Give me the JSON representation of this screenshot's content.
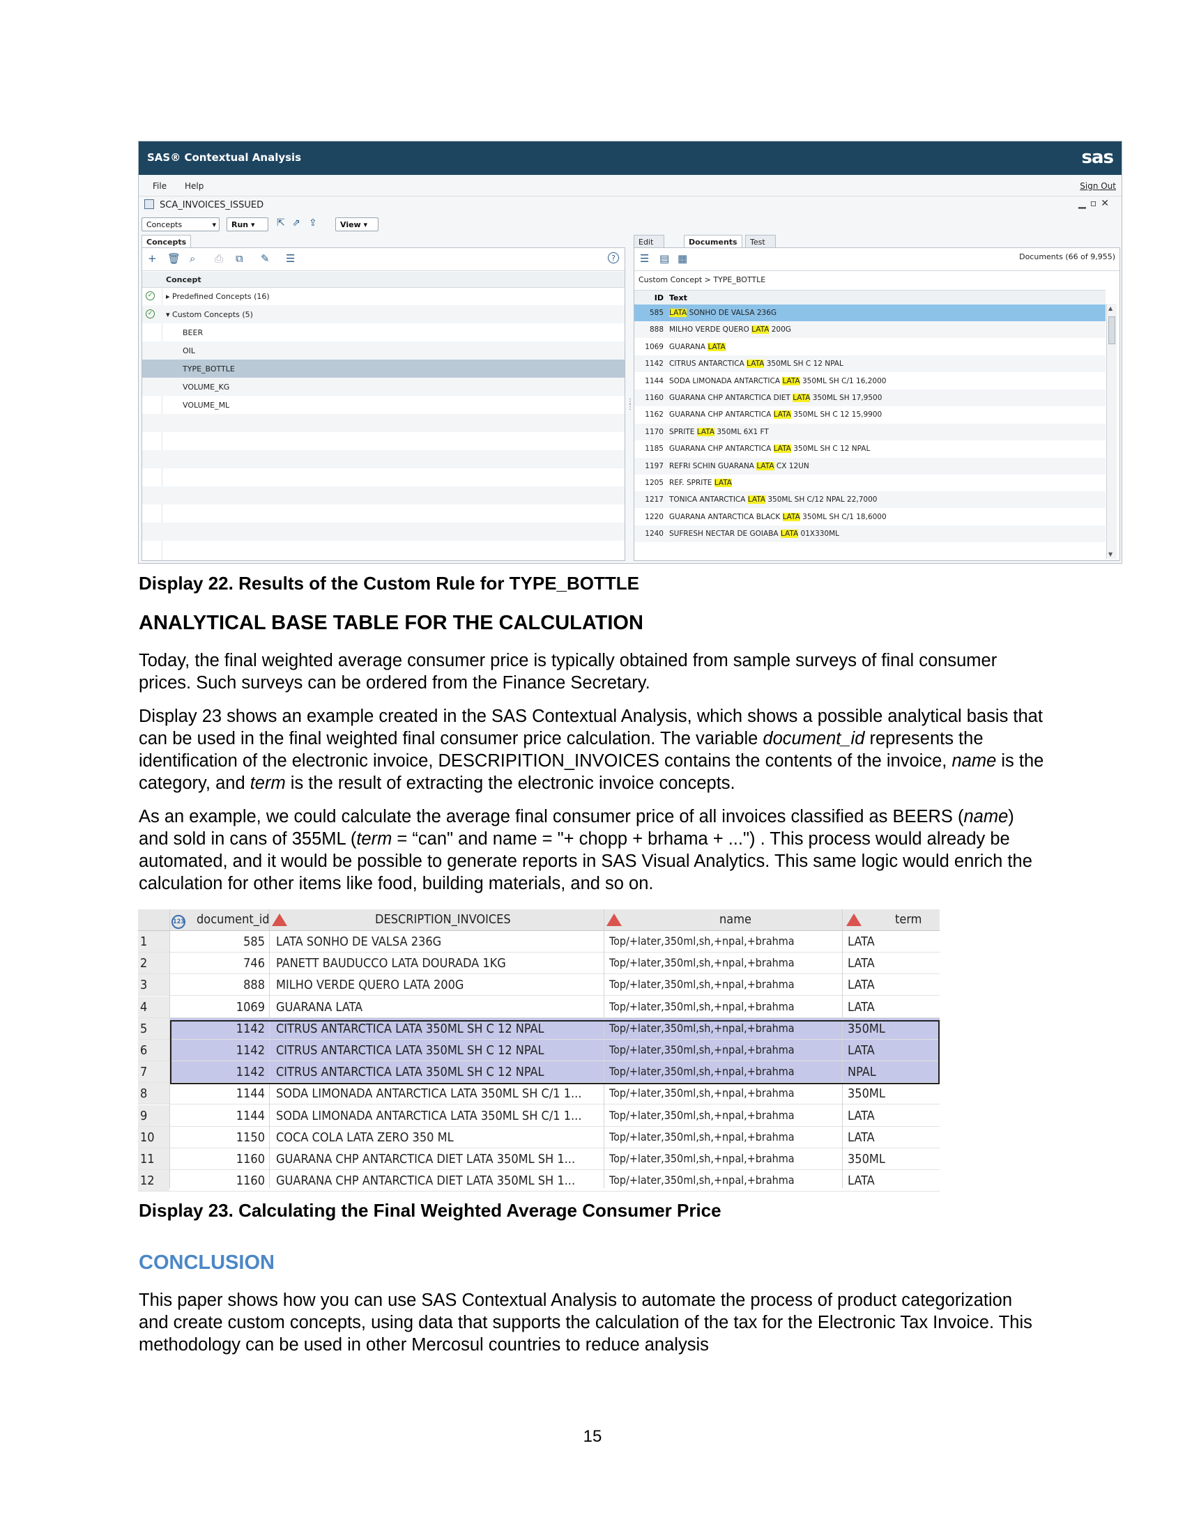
{
  "app": {
    "title": "SAS® Contextual Analysis",
    "logo": "sas",
    "menu": [
      "File",
      "Help"
    ],
    "sign_out": "Sign Out",
    "project": "SCA_INVOICES_ISSUED",
    "toolbar": {
      "concepts_select": "Concepts",
      "run": "Run",
      "view": "View"
    },
    "left_tab": "Concepts",
    "concept_header": "Concept",
    "concepts": [
      {
        "label": "▸ Predefined Concepts (16)",
        "check": true,
        "indent": false,
        "selected": false
      },
      {
        "label": "▾ Custom Concepts (5)",
        "check": true,
        "indent": false,
        "selected": false
      },
      {
        "label": "BEER",
        "check": false,
        "indent": true,
        "selected": false
      },
      {
        "label": "OIL",
        "check": false,
        "indent": true,
        "selected": false
      },
      {
        "label": "TYPE_BOTTLE",
        "check": false,
        "indent": true,
        "selected": true
      },
      {
        "label": "VOLUME_KG",
        "check": false,
        "indent": true,
        "selected": false
      },
      {
        "label": "VOLUME_ML",
        "check": false,
        "indent": true,
        "selected": false
      }
    ],
    "right_tabs": [
      "Edit Rules",
      "Documents",
      "Test Rules"
    ],
    "documents_info": "Documents (66 of 9,955)",
    "breadcrumb": "Custom Concept > TYPE_BOTTLE",
    "doc_headers": {
      "id": "ID",
      "text": "Text"
    },
    "documents": [
      {
        "id": "585",
        "pre": "",
        "hl": "LATA",
        "post": " SONHO DE VALSA 236G"
      },
      {
        "id": "888",
        "pre": "MILHO VERDE QUERO ",
        "hl": "LATA",
        "post": " 200G"
      },
      {
        "id": "1069",
        "pre": "GUARANA ",
        "hl": "LATA",
        "post": ""
      },
      {
        "id": "1142",
        "pre": "CITRUS ANTARCTICA ",
        "hl": "LATA",
        "post": " 350ML SH C 12 NPAL"
      },
      {
        "id": "1144",
        "pre": "SODA LIMONADA ANTARCTICA ",
        "hl": "LATA",
        "post": " 350ML SH C/1 16,2000"
      },
      {
        "id": "1160",
        "pre": "GUARANA CHP ANTARCTICA DIET ",
        "hl": "LATA",
        "post": " 350ML SH 17,9500"
      },
      {
        "id": "1162",
        "pre": "GUARANA CHP ANTARCTICA ",
        "hl": "LATA",
        "post": " 350ML SH C 12 15,9900"
      },
      {
        "id": "1170",
        "pre": "SPRITE ",
        "hl": "LATA",
        "post": " 350ML 6X1 FT"
      },
      {
        "id": "1185",
        "pre": "GUARANA CHP ANTARCTICA ",
        "hl": "LATA",
        "post": " 350ML SH C 12 NPAL"
      },
      {
        "id": "1197",
        "pre": "REFRI SCHIN GUARANA ",
        "hl": "LATA",
        "post": " CX 12UN"
      },
      {
        "id": "1205",
        "pre": "REF. SPRITE ",
        "hl": "LATA",
        "post": ""
      },
      {
        "id": "1217",
        "pre": "TONICA ANTARCTICA ",
        "hl": "LATA",
        "post": " 350ML SH C/12 NPAL 22,7000"
      },
      {
        "id": "1220",
        "pre": "GUARANA ANTARCTICA BLACK ",
        "hl": "LATA",
        "post": " 350ML SH C/1 18,6000"
      },
      {
        "id": "1240",
        "pre": "SUFRESH NECTAR DE GOIABA ",
        "hl": "LATA",
        "post": " 01X330ML"
      }
    ]
  },
  "caption22": "Display 22. Results of the Custom Rule for TYPE_BOTTLE",
  "heading_abt": "ANALYTICAL BASE TABLE FOR THE CALCULATION",
  "p1": "Today, the final weighted average consumer price is typically obtained from sample surveys of final consumer prices. Such surveys can be ordered from the Finance Secretary.",
  "p2": {
    "a": "Display 23 shows an example created in the SAS Contextual Analysis, which shows a possible analytical basis that can be used in the final weighted final consumer price calculation. The variable ",
    "b": "document_id",
    "c": " represents the identification of the electronic invoice, DESCRIPITION_INVOICES contains the contents of the invoice, ",
    "d": "name",
    "e": " is the category, and ",
    "f": "term",
    "g": " is the result of extracting the electronic invoice concepts."
  },
  "p3": {
    "a": "As an example, we could calculate the average final consumer price of all invoices classified as BEERS (",
    "b": "name",
    "c": ") and sold in cans of 355ML (",
    "d": "term",
    "e": " = “can\" and name = \"+ chopp + brhama + ...\") . This process would already be automated, and it would be possible to generate reports in SAS Visual Analytics. This same logic would enrich the calculation for other items like food, building materials, and so on."
  },
  "table": {
    "headers": {
      "id": "document_id",
      "desc": "DESCRIPTION_INVOICES",
      "name": "name",
      "term": "term"
    },
    "rows": [
      {
        "n": "1",
        "id": "585",
        "desc": "LATA SONHO DE VALSA 236G",
        "name": "Top/+later,350ml,sh,+npal,+brahma",
        "term": "LATA",
        "hl": false
      },
      {
        "n": "2",
        "id": "746",
        "desc": "PANETT BAUDUCCO LATA DOURADA 1KG",
        "name": "Top/+later,350ml,sh,+npal,+brahma",
        "term": "LATA",
        "hl": false
      },
      {
        "n": "3",
        "id": "888",
        "desc": "MILHO VERDE QUERO LATA 200G",
        "name": "Top/+later,350ml,sh,+npal,+brahma",
        "term": "LATA",
        "hl": false
      },
      {
        "n": "4",
        "id": "1069",
        "desc": "GUARANA LATA",
        "name": "Top/+later,350ml,sh,+npal,+brahma",
        "term": "LATA",
        "hl": false
      },
      {
        "n": "5",
        "id": "1142",
        "desc": "CITRUS ANTARCTICA LATA 350ML SH C 12 NPAL",
        "name": "Top/+later,350ml,sh,+npal,+brahma",
        "term": "350ML",
        "hl": true
      },
      {
        "n": "6",
        "id": "1142",
        "desc": "CITRUS ANTARCTICA LATA 350ML SH C 12 NPAL",
        "name": "Top/+later,350ml,sh,+npal,+brahma",
        "term": "LATA",
        "hl": true
      },
      {
        "n": "7",
        "id": "1142",
        "desc": "CITRUS ANTARCTICA LATA 350ML SH C 12 NPAL",
        "name": "Top/+later,350ml,sh,+npal,+brahma",
        "term": "NPAL",
        "hl": true
      },
      {
        "n": "8",
        "id": "1144",
        "desc": "SODA LIMONADA ANTARCTICA LATA 350ML SH C/1 1...",
        "name": "Top/+later,350ml,sh,+npal,+brahma",
        "term": "350ML",
        "hl": false
      },
      {
        "n": "9",
        "id": "1144",
        "desc": "SODA LIMONADA ANTARCTICA LATA 350ML SH C/1 1...",
        "name": "Top/+later,350ml,sh,+npal,+brahma",
        "term": "LATA",
        "hl": false
      },
      {
        "n": "10",
        "id": "1150",
        "desc": "COCA COLA LATA ZERO 350 ML",
        "name": "Top/+later,350ml,sh,+npal,+brahma",
        "term": "LATA",
        "hl": false
      },
      {
        "n": "11",
        "id": "1160",
        "desc": "GUARANA CHP ANTARCTICA DIET LATA 350ML SH 1...",
        "name": "Top/+later,350ml,sh,+npal,+brahma",
        "term": "350ML",
        "hl": false
      },
      {
        "n": "12",
        "id": "1160",
        "desc": "GUARANA CHP ANTARCTICA DIET LATA 350ML SH 1...",
        "name": "Top/+later,350ml,sh,+npal,+brahma",
        "term": "LATA",
        "hl": false
      }
    ]
  },
  "caption23": "Display 23. Calculating the Final Weighted Average Consumer Price",
  "heading_conclusion": "CONCLUSION",
  "p4": "This paper shows how you can use SAS Contextual Analysis to automate the process of product categorization and create custom concepts, using data that supports the calculation of the tax for the Electronic Tax Invoice. This methodology can be used in other Mercosul countries to reduce analysis",
  "page_number": "15"
}
